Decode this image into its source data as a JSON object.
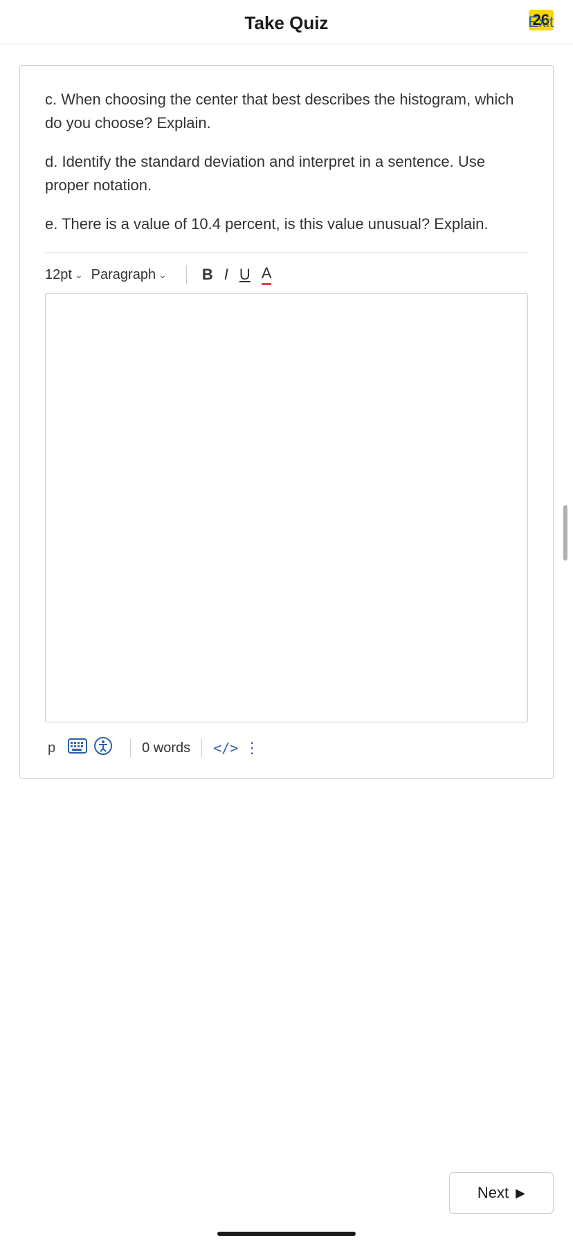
{
  "header": {
    "title": "Take Quiz",
    "exit_label": "Exit",
    "badge_number": "26"
  },
  "question": {
    "part_c": "c. When choosing the center that best describes the histogram, which do you choose? Explain.",
    "part_d": "d. Identify the standard deviation and interpret in a sentence. Use proper notation.",
    "part_e": "e. There is a value of 10.4 percent, is this value unusual? Explain."
  },
  "toolbar": {
    "font_size": "12pt",
    "paragraph": "Paragraph",
    "bold_label": "B",
    "italic_label": "I",
    "underline_label": "U",
    "text_color_label": "A"
  },
  "editor": {
    "placeholder": "",
    "content": ""
  },
  "status_bar": {
    "p_label": "p",
    "words_label": "0 words",
    "code_label": "</>",
    "keyboard_icon": "⌨",
    "accessibility_icon": "ⓘ"
  },
  "navigation": {
    "next_label": "Next"
  }
}
